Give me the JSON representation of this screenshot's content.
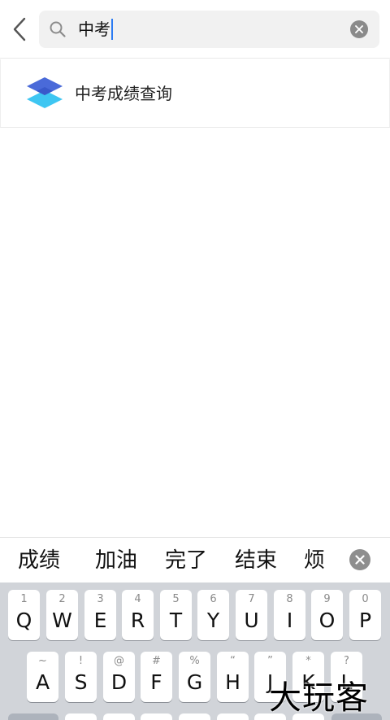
{
  "search": {
    "query": "中考"
  },
  "results": [
    {
      "title": "中考成绩查询"
    }
  ],
  "candidates": [
    "成绩",
    "加油",
    "完了",
    "结束",
    "烦"
  ],
  "keyboard": {
    "row1": [
      {
        "num": "1",
        "key": "Q"
      },
      {
        "num": "2",
        "key": "W"
      },
      {
        "num": "3",
        "key": "E"
      },
      {
        "num": "4",
        "key": "R"
      },
      {
        "num": "5",
        "key": "T"
      },
      {
        "num": "6",
        "key": "Y"
      },
      {
        "num": "7",
        "key": "U"
      },
      {
        "num": "8",
        "key": "I"
      },
      {
        "num": "9",
        "key": "O"
      },
      {
        "num": "0",
        "key": "P"
      }
    ],
    "row2": [
      {
        "num": "~",
        "key": "A"
      },
      {
        "num": "!",
        "key": "S"
      },
      {
        "num": "@",
        "key": "D"
      },
      {
        "num": "#",
        "key": "F"
      },
      {
        "num": "%",
        "key": "G"
      },
      {
        "num": "“",
        "key": "H"
      },
      {
        "num": "”",
        "key": "J"
      },
      {
        "num": "*",
        "key": "K"
      },
      {
        "num": "?",
        "key": "L"
      }
    ]
  },
  "watermark": "大玩客",
  "colors": {
    "caret": "#2b7bf3",
    "icon_top": "#4a6ad9",
    "icon_bottom": "#3ec6f2"
  }
}
